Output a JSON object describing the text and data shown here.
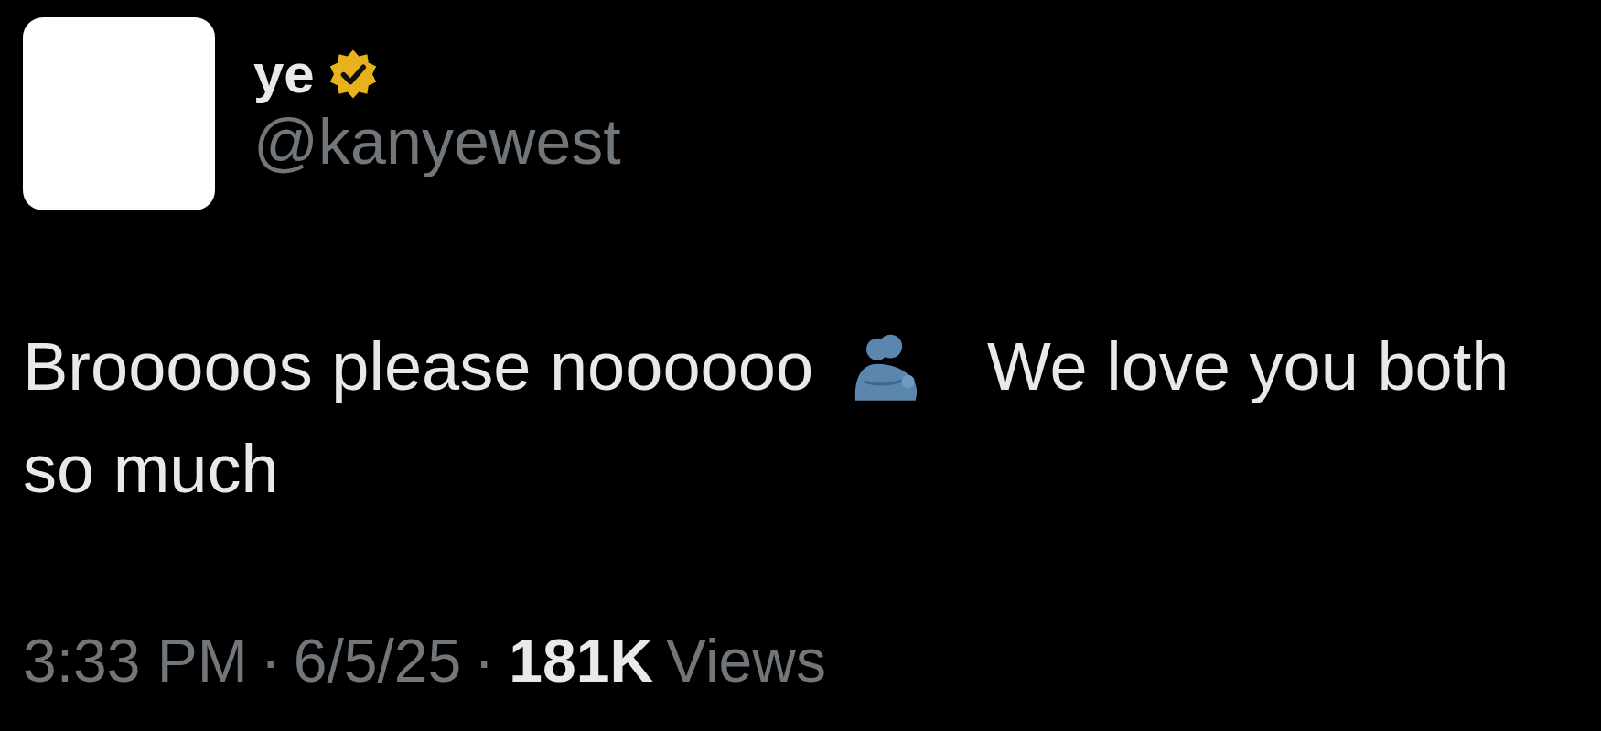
{
  "author": {
    "name": "ye",
    "verified": true,
    "handle": "@kanyewest"
  },
  "tweet": {
    "text_before": "Brooooos please noooooo",
    "text_after": "We love you both",
    "text_continued": "so much"
  },
  "meta": {
    "time": "3:33 PM",
    "separator_1": "·",
    "date": "6/5/25",
    "separator_2": "·",
    "views_count": "181K",
    "views_label": "Views"
  }
}
